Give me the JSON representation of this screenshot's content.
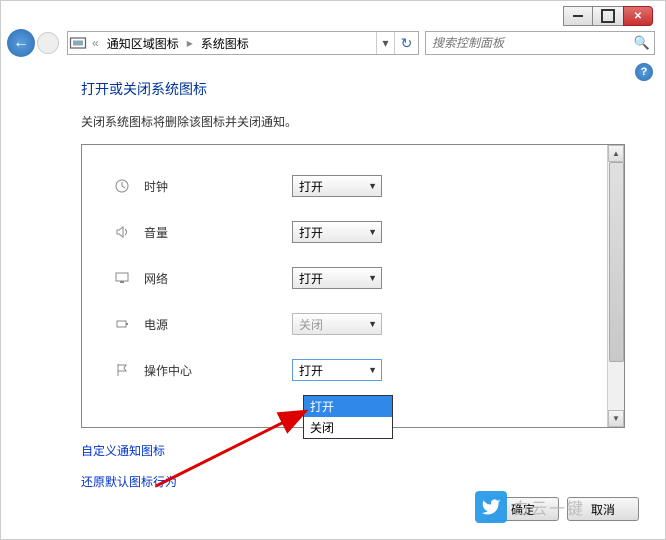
{
  "titlebar": {
    "min": "",
    "max": "",
    "close": ""
  },
  "nav": {
    "breadcrumb1": "通知区域图标",
    "breadcrumb2": "系统图标",
    "search_placeholder": "搜索控制面板"
  },
  "page": {
    "title": "打开或关闭系统图标",
    "desc": "关闭系统图标将删除该图标并关闭通知。"
  },
  "rows": {
    "clock": {
      "label": "时钟",
      "value": "打开"
    },
    "volume": {
      "label": "音量",
      "value": "打开"
    },
    "network": {
      "label": "网络",
      "value": "打开"
    },
    "power": {
      "label": "电源",
      "value": "关闭"
    },
    "action": {
      "label": "操作中心",
      "value": "打开"
    }
  },
  "dropdown_options": {
    "open": "打开",
    "close": "关闭"
  },
  "links": {
    "customize": "自定义通知图标",
    "restore": "还原默认图标行为"
  },
  "footer": {
    "ok": "确定",
    "cancel": "取消"
  },
  "watermark": "白云一键"
}
